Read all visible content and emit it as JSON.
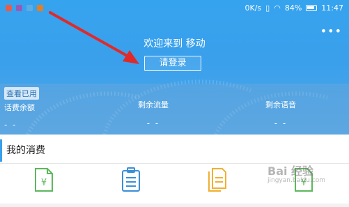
{
  "status_bar": {
    "speed": "0K/s",
    "battery": "84%",
    "time": "11:47"
  },
  "header": {
    "welcome": "欢迎来到  移动",
    "login_button": "请登录",
    "menu_icon": "more-dots-icon"
  },
  "stats": {
    "badge": "查看已用",
    "items": [
      {
        "label": "话费余额",
        "value": "- -"
      },
      {
        "label": "剩余流量",
        "value": "- -"
      },
      {
        "label": "剩余语音",
        "value": "- -"
      }
    ]
  },
  "consumption": {
    "title": "我的消费",
    "tiles": [
      {
        "icon": "yuan-document-icon",
        "color": "#5cb85c"
      },
      {
        "icon": "clipboard-list-icon",
        "color": "#3a8fd8"
      },
      {
        "icon": "copy-document-icon",
        "color": "#f0b030"
      },
      {
        "icon": "yuan-upload-icon",
        "color": "#5cb85c"
      }
    ]
  },
  "watermark": {
    "text": "Bai 经验",
    "sub": "jingyan.baidu.com"
  },
  "colors": {
    "accent": "#3aa0ec",
    "arrow": "#e02a2a"
  }
}
